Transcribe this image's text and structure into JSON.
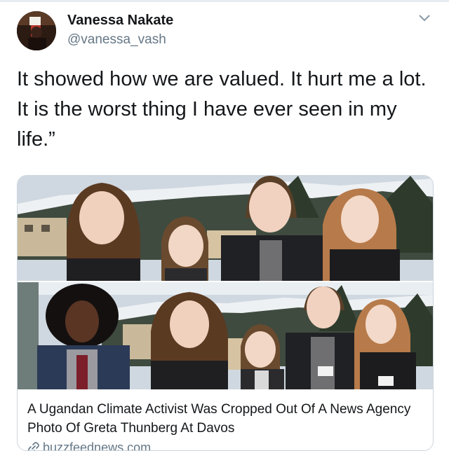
{
  "tweet": {
    "author_name": "Vanessa Nakate",
    "author_handle": "@vanessa_vash",
    "text": "It showed how we are valued. It hurt me a lot. It is the worst thing I have ever seen in my life.”"
  },
  "card": {
    "title": "A Ugandan Climate Activist Was Cropped Out Of A News Agency Photo Of Greta Thunberg At Davos",
    "domain": "buzzfeednews.com"
  },
  "icons": {
    "menu": "chevron-down-icon",
    "link": "link-icon"
  },
  "colors": {
    "text_primary": "#14171a",
    "text_secondary": "#657786",
    "border": "#ccd6dd"
  }
}
